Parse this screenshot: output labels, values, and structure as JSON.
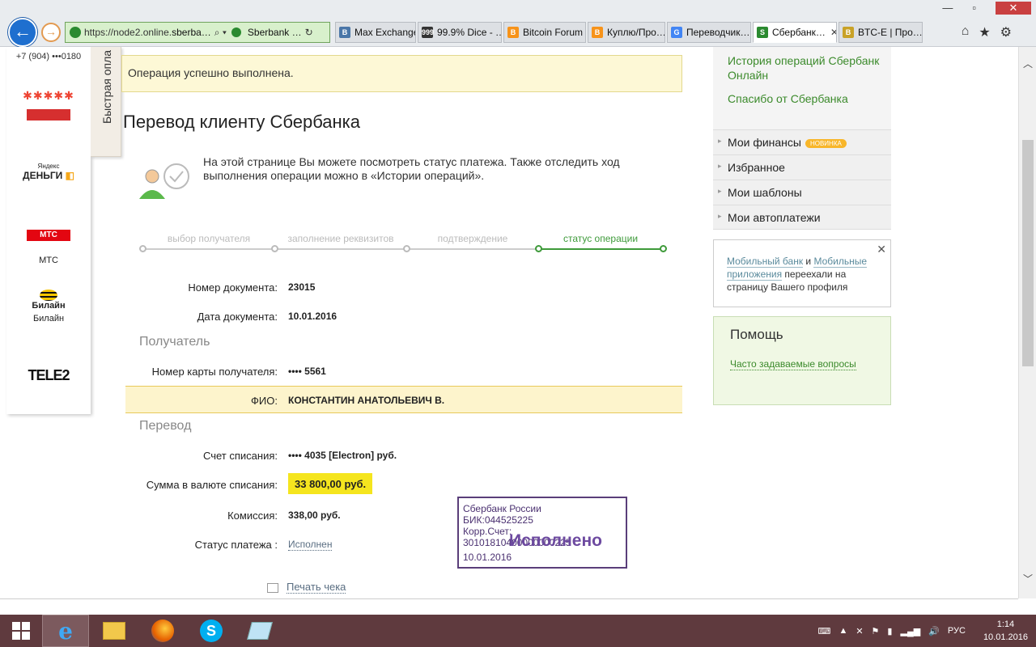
{
  "browser": {
    "url_prefix": "https://node2.online.",
    "url_domain": "sberba…",
    "site_label": "Sberbank …",
    "tabs": [
      {
        "label": "Max Exchange",
        "icon": "vk-icon",
        "color": "#4a76a8",
        "glyph": "B"
      },
      {
        "label": "99.9% Dice - …",
        "icon": "dice-icon",
        "color": "#333333",
        "glyph": "999"
      },
      {
        "label": "Bitcoin Forum",
        "icon": "bitcoin-icon",
        "color": "#f7931a",
        "glyph": "B"
      },
      {
        "label": "Куплю/Про…",
        "icon": "bitcoin-icon",
        "color": "#f7931a",
        "glyph": "B"
      },
      {
        "label": "Переводчик…",
        "icon": "google-translate-icon",
        "color": "#4285f4",
        "glyph": "G"
      },
      {
        "label": "Сбербанк…",
        "icon": "sberbank-icon",
        "color": "#2b8a30",
        "glyph": "S",
        "active": true
      },
      {
        "label": "BTC-E | Про…",
        "icon": "btce-icon",
        "color": "#c9a227",
        "glyph": "B"
      }
    ]
  },
  "left_panel": {
    "phone": "+7 (904) •••0180",
    "quick_pay": "Быстрая опла",
    "providers": [
      {
        "name": ""
      },
      {
        "name": ""
      },
      {
        "name": "МТС"
      },
      {
        "name": "Билайн"
      },
      {
        "name": ""
      }
    ],
    "logo_texts": {
      "yandex_small": "Яндекс",
      "yandex_big": "ДЕНЬГИ",
      "mts": "МТС",
      "beeline": "Билайн",
      "tele2": "TELE2"
    }
  },
  "main": {
    "success_message": "Операция успешно выполнена.",
    "title": "Перевод клиенту Сбербанка",
    "info_text": "На этой странице Вы можете посмотреть статус платежа. Также отследить ход выполнения операции можно в «Истории операций».",
    "steps": [
      "выбор получателя",
      "заполнение реквизитов",
      "подтверждение",
      "статус операции"
    ],
    "doc_number_label": "Номер документа:",
    "doc_number": "23015",
    "doc_date_label": "Дата документа:",
    "doc_date": "10.01.2016",
    "section_recipient": "Получатель",
    "card_label": "Номер карты получателя:",
    "card_value": "•••• 5561",
    "fio_label": "ФИО:",
    "fio_value": "КОНСТАНТИН АНАТОЛЬЕВИЧ В.",
    "section_transfer": "Перевод",
    "account_label": "Счет списания:",
    "account_value": "•••• 4035  [Electron]  руб.",
    "amount_label": "Сумма в валюте списания:",
    "amount_value": "33 800,00  руб.",
    "fee_label": "Комиссия:",
    "fee_value": "338,00 руб.",
    "status_label": "Статус платежа :",
    "status_value": "Исполнен",
    "print_label": "Печать чека",
    "stamp": {
      "line1": "Сбербанк России",
      "line2": "БИК:044525225",
      "line3": "Корр.Счет: 30101810400000000225",
      "big": "Исполнено",
      "date": "10.01.2016"
    }
  },
  "right": {
    "links": [
      "История операций Сбербанк Онлайн",
      "Спасибо от Сбербанка"
    ],
    "menu": [
      "Мои финансы",
      "Избранное",
      "Мои шаблоны",
      "Мои автоплатежи"
    ],
    "new_badge": "НОВИНКА",
    "notice_link1": "Мобильный банк",
    "notice_and": " и ",
    "notice_link2": "Мобильные приложения",
    "notice_rest": " переехали на страницу Вашего профиля",
    "help_title": "Помощь",
    "help_link": "Часто задаваемые вопросы"
  },
  "taskbar": {
    "lang": "РУС",
    "time": "1:14",
    "date": "10.01.2016"
  },
  "colors": {
    "sber_green": "#2b8a30",
    "accent_yellow": "#f5e51e",
    "taskbar": "#5f3a3e"
  }
}
